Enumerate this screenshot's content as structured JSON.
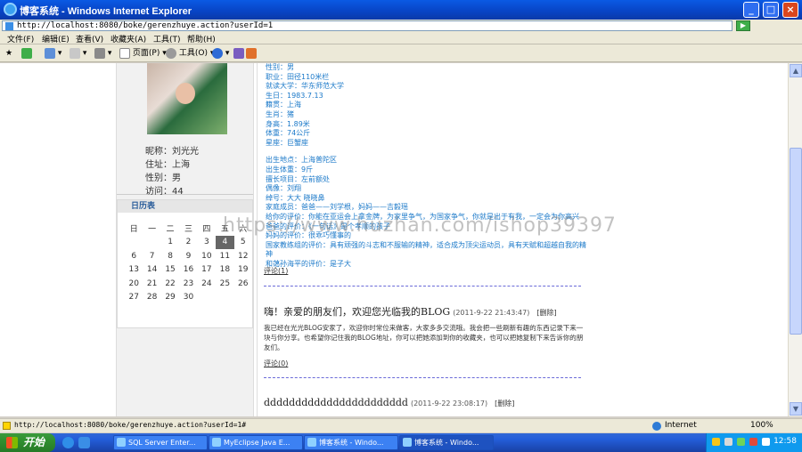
{
  "window": {
    "title": "博客系统 - Windows Internet Explorer"
  },
  "address": {
    "url": "http://localhost:8080/boke/gerenzhuye.action?userId=1"
  },
  "menu": [
    "文件(F)",
    "编辑(E)",
    "查看(V)",
    "收藏夹(A)",
    "工具(T)",
    "帮助(H)"
  ],
  "toolbar": {
    "page_label": "页面(P)",
    "tools_label": "工具(O)"
  },
  "profile": {
    "nickname": "昵称：刘光光",
    "address": "住址：上海",
    "gender": "性别：男",
    "visits": "访问：44"
  },
  "calendar": {
    "title": "日历表",
    "weekdays": [
      "日",
      "一",
      "二",
      "三",
      "四",
      "五",
      "六"
    ],
    "weeks": [
      [
        "",
        "",
        "1",
        "2",
        "3",
        "4",
        "5"
      ],
      [
        "6",
        "7",
        "8",
        "9",
        "10",
        "11",
        "12"
      ],
      [
        "13",
        "14",
        "15",
        "16",
        "17",
        "18",
        "19"
      ],
      [
        "20",
        "21",
        "22",
        "23",
        "24",
        "25",
        "26"
      ],
      [
        "27",
        "28",
        "29",
        "30",
        "",
        "",
        ""
      ]
    ],
    "today": "4"
  },
  "info": {
    "lines_a": [
      "性别：男",
      "职业：田径110米栏",
      "就读大学：华东师范大学",
      "生日：1983.7.13",
      "籍贯：上海",
      "生肖：猪",
      "身高：1.89米",
      "体重：74公斤",
      "星座：巨蟹座"
    ],
    "lines_b": [
      "出生地点：上海普陀区",
      "出生体重：9斤",
      "擅长项目：左前额处",
      "偶像：刘翔",
      "绰号：大大  晓晓鼻",
      "家庭成员：爸爸——刘学根，妈妈——吉毅瑶",
      "给你的评价：你能在亚运会上拿金牌，为家里争气，为国家争气，你就是出于有我，一定会为你高兴",
      "爸爸的评价：《一句话》是个孝顺的孩子",
      "妈妈的评价：很乖巧懂事的",
      "国家教练组的评价：具有顽强的斗志和不服输的精神，适合成为顶尖运动员，具有天赋和超越自我的精神",
      "和蔼孙海平的评价：是子大"
    ]
  },
  "posts": [
    {
      "comment_above": "评论(1)",
      "title": "嗨！亲爱的朋友们，欢迎您光临我的BLOG",
      "time": "(2011-9-22 21:43:47)",
      "delete": "[删除]",
      "body": "我已经在光光BLOG安家了，欢迎你时常位来做客，大家多多交流哦。我会把一些刷新有趣的东西记录下来一块与你分享。也希望你记住我的BLOG地址，你可以把她添加到你的收藏夹，也可以把她复制下来告诉你的朋友们。",
      "comment": "评论(0)"
    },
    {
      "title": "ddddddddddddddddddddddd",
      "time": "(2011-9-22 23:08:17)",
      "delete": "[删除]"
    }
  ],
  "watermark": "https://www.huzhan.com/ishop39397",
  "status": {
    "url": "http://localhost:8080/boke/gerenzhuye.action?userId=1#",
    "zone": "Internet",
    "zoom": "100%"
  },
  "taskbar": {
    "start": "开始",
    "tasks": [
      "SQL Server Enter...",
      "MyEclipse Java E...",
      "博客系统 - Windo...",
      "博客系统 - Windo..."
    ],
    "clock": "12:58"
  }
}
